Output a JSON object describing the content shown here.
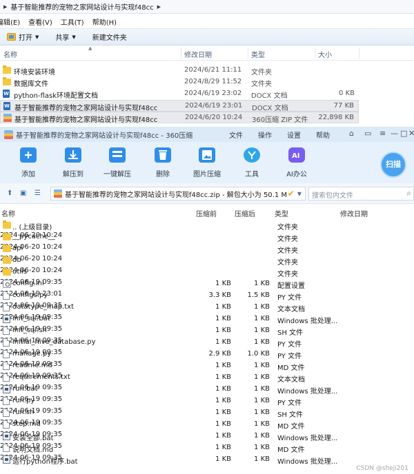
{
  "explorer": {
    "breadcrumb": "基于智能推荐的宠物之家网站设计与实现f48cc",
    "menu": [
      "编辑(E)",
      "查看(V)",
      "工具(T)",
      "帮助(H)"
    ],
    "toolbar": {
      "open": "打开",
      "share": "共享",
      "new_folder": "新建文件夹"
    },
    "columns": {
      "name": "名称",
      "date": "修改日期",
      "type": "类型",
      "size": "大小"
    },
    "rows": [
      {
        "name": "环境安装环境",
        "date": "2024/6/21 11:11",
        "type": "文件夹",
        "size": "",
        "icon": "folder-icon"
      },
      {
        "name": "数据库文件",
        "date": "2024/8/29 11:52",
        "type": "文件夹",
        "size": "",
        "icon": "folder-icon"
      },
      {
        "name": "python-flask环境配置文档",
        "date": "2024/6/19 23:02",
        "type": "DOCX 文档",
        "size": "0 KB",
        "icon": "docx-icon"
      },
      {
        "name": "基于智能推荐的宠物之家网站设计与实现f48cc",
        "date": "2024/6/19 23:01",
        "type": "DOCX 文档",
        "size": "77 KB",
        "icon": "docx-icon"
      },
      {
        "name": "基于智能推荐的宠物之家网站设计与实现f48cc",
        "date": "2024/6/20 10:24",
        "type": "360压缩 ZIP 文件",
        "size": "22,898 KB",
        "icon": "zip-icon"
      }
    ]
  },
  "zip": {
    "title": "基于智能推荐的宠物之家网站设计与实现f48cc - 360压缩",
    "menu": [
      "文件",
      "操作",
      "设置",
      "帮助"
    ],
    "tools": [
      {
        "label": "添加",
        "icon": "add-icon",
        "color": "#2f8ee8"
      },
      {
        "label": "解压到",
        "icon": "extract-to-icon",
        "color": "#2f8ee8"
      },
      {
        "label": "一键解压",
        "icon": "one-click-extract-icon",
        "color": "#2f8ee8"
      },
      {
        "label": "删除",
        "icon": "delete-icon",
        "color": "#2f8ee8"
      },
      {
        "label": "图片压缩",
        "icon": "image-compress-icon",
        "color": "#2f8ee8"
      },
      {
        "label": "工具",
        "icon": "tools-icon",
        "color": "#2fa6e8"
      },
      {
        "label": "AI办公",
        "icon": "ai-office-icon",
        "color": "#7a5cf0"
      }
    ],
    "scan": "扫描",
    "path": "基于智能推荐的宠物之家网站设计与实现f48cc.zip - 解包大小为 50.1 MB",
    "search_placeholder": "搜索包内文件",
    "columns": {
      "name": "名称",
      "orig": "压缩前",
      "comp": "压缩后",
      "type": "类型",
      "modified": "修改日期"
    },
    "rows": [
      {
        "name": ".. (上级目录)",
        "orig": "",
        "comp": "",
        "type": "文件夹",
        "modified": "",
        "icon": "folder-icon"
      },
      {
        "name": "__pycache__",
        "orig": "",
        "comp": "",
        "type": "文件夹",
        "modified": "2024-06-20 10:24",
        "icon": "folder-icon"
      },
      {
        "name": "api",
        "orig": "",
        "comp": "",
        "type": "文件夹",
        "modified": "2024-06-20 10:24",
        "icon": "folder-icon"
      },
      {
        "name": "db",
        "orig": "",
        "comp": "",
        "type": "文件夹",
        "modified": "2024-06-20 10:24",
        "icon": "folder-icon"
      },
      {
        "name": "utils",
        "orig": "",
        "comp": "",
        "type": "文件夹",
        "modified": "2024-06-20 10:24",
        "icon": "folder-icon"
      },
      {
        "name": "config.ini",
        "orig": "1 KB",
        "comp": "1 KB",
        "type": "配置设置",
        "modified": "2024-06-19 09:35",
        "icon": "config-icon"
      },
      {
        "name": "configs.py",
        "orig": "3.3 KB",
        "comp": "1.5 KB",
        "type": "PY 文件",
        "modified": "2024-06-19 23:01",
        "icon": "file-icon"
      },
      {
        "name": "datatype_map.txt",
        "orig": "1 KB",
        "comp": "1 KB",
        "type": "文本文档",
        "modified": "2024-06-19 09:35",
        "icon": "file-icon"
      },
      {
        "name": "init_sql.bat",
        "orig": "1 KB",
        "comp": "1 KB",
        "type": "Windows 批处理...",
        "modified": "2024-06-19 09:35",
        "icon": "bat-icon"
      },
      {
        "name": "init_sql.sh",
        "orig": "1 KB",
        "comp": "1 KB",
        "type": "SH 文件",
        "modified": "2024-06-19 09:35",
        "icon": "file-icon"
      },
      {
        "name": "initial_hive_database.py",
        "orig": "1 KB",
        "comp": "1 KB",
        "type": "PY 文件",
        "modified": "2024-06-19 09:35",
        "icon": "file-icon"
      },
      {
        "name": "manage.py",
        "orig": "2.9 KB",
        "comp": "1.0 KB",
        "type": "PY 文件",
        "modified": "2024-06-19 09:35",
        "icon": "file-icon"
      },
      {
        "name": "readme.md",
        "orig": "1 KB",
        "comp": "1 KB",
        "type": "MD 文件",
        "modified": "2024-06-19 09:35",
        "icon": "file-icon"
      },
      {
        "name": "requirements.txt",
        "orig": "1 KB",
        "comp": "1 KB",
        "type": "文本文档",
        "modified": "2024-06-19 09:35",
        "icon": "file-icon"
      },
      {
        "name": "run.bat",
        "orig": "1 KB",
        "comp": "1 KB",
        "type": "Windows 批处理...",
        "modified": "2024-06-19 09:35",
        "icon": "bat-icon"
      },
      {
        "name": "run.py",
        "orig": "1 KB",
        "comp": "1 KB",
        "type": "PY 文件",
        "modified": "2024-06-19 09:35",
        "icon": "file-icon"
      },
      {
        "name": "run.sh",
        "orig": "1 KB",
        "comp": "1 KB",
        "type": "SH 文件",
        "modified": "2024-06-19 09:35",
        "icon": "file-icon"
      },
      {
        "name": "step.md",
        "orig": "1 KB",
        "comp": "1 KB",
        "type": "MD 文件",
        "modified": "2024-06-19 09:35",
        "icon": "file-icon"
      },
      {
        "name": "安装全部.bat",
        "orig": "1 KB",
        "comp": "1 KB",
        "type": "Windows 批处理...",
        "modified": "2024-06-19 09:35",
        "icon": "bat-icon"
      },
      {
        "name": "说明文档.md",
        "orig": "1 KB",
        "comp": "1 KB",
        "type": "MD 文件",
        "modified": "2024-06-19 09:35",
        "icon": "file-icon"
      },
      {
        "name": "运行python程序.bat",
        "orig": "1 KB",
        "comp": "1 KB",
        "type": "Windows 批处理...",
        "modified": "2024-06-19 09:35",
        "icon": "bat-icon"
      }
    ]
  },
  "watermark": "CSDN @sheji201"
}
